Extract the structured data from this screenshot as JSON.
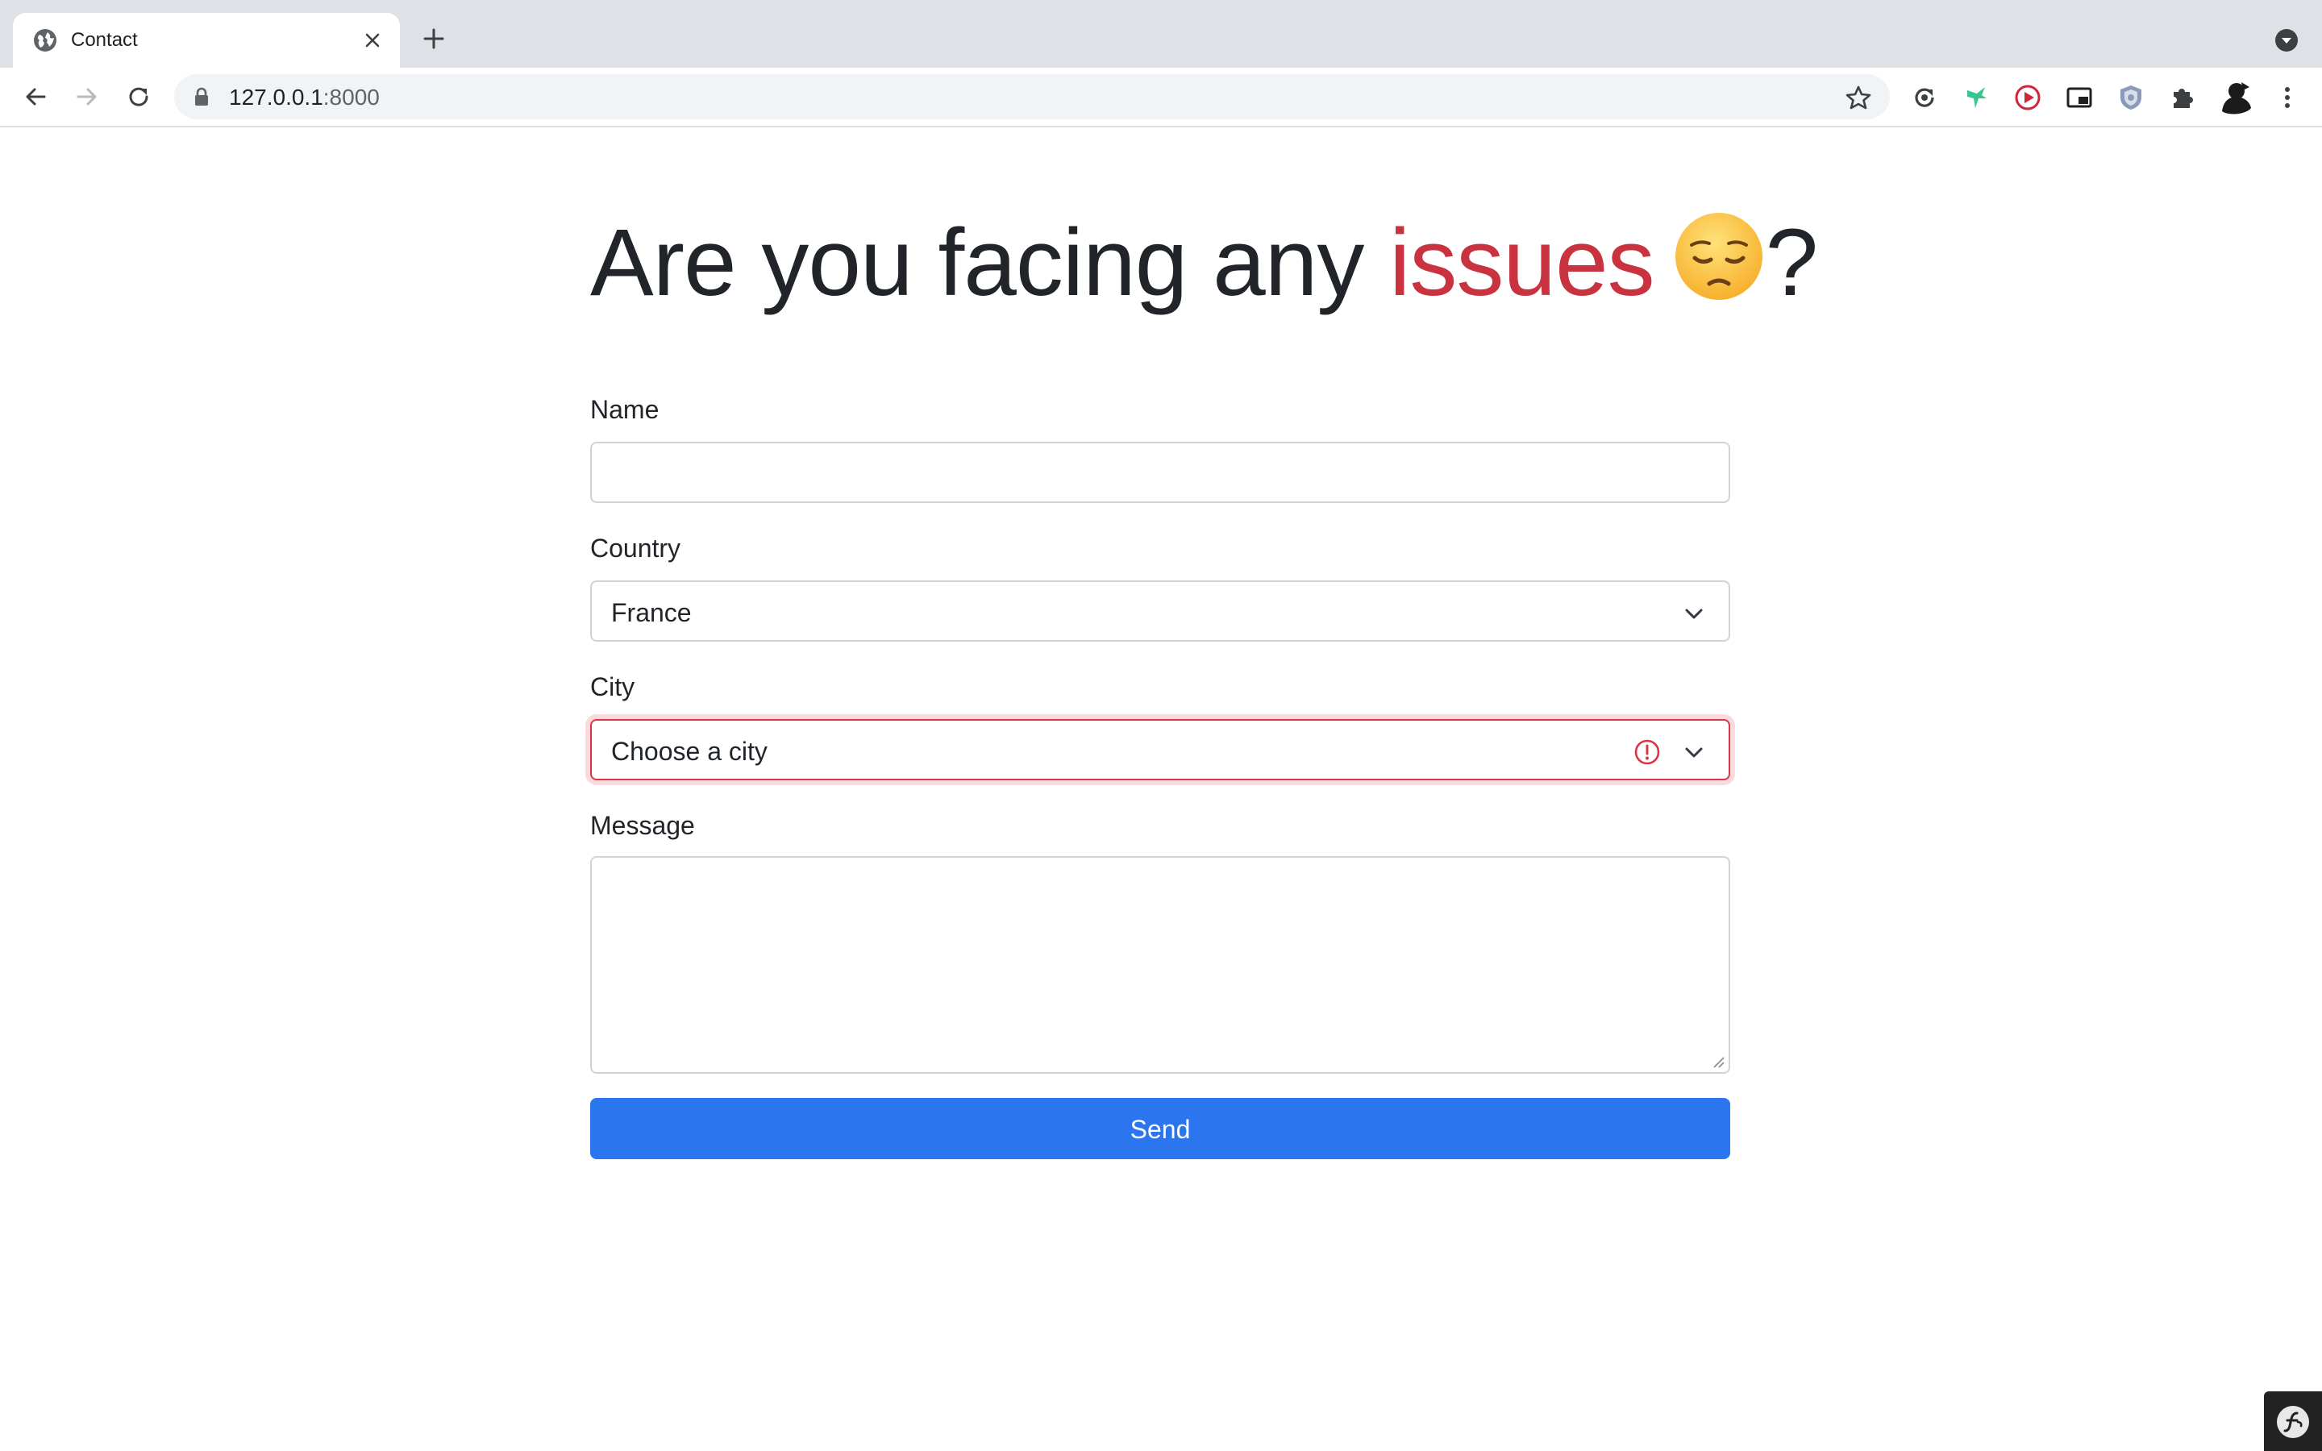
{
  "browser": {
    "tab_title": "Contact",
    "url_host": "127.0.0.1",
    "url_port": ":8000",
    "icons": [
      "globe-icon",
      "close-icon",
      "plus-icon",
      "chevron-down-icon",
      "back-arrow-icon",
      "forward-arrow-icon",
      "reload-icon",
      "lock-icon",
      "star-icon",
      "sync-extension-icon",
      "bird-extension-icon",
      "play-extension-icon",
      "picture-in-picture-icon",
      "shield-extension-icon",
      "puzzle-icon",
      "avatar",
      "more-vert-icon"
    ]
  },
  "heading": {
    "before": "Are you facing any ",
    "accent": "issues",
    "emoji_name": "pensive-face-emoji",
    "after": "?",
    "accent_color": "#c9333f"
  },
  "form": {
    "name_label": "Name",
    "name_value": "",
    "country_label": "Country",
    "country_value": "France",
    "city_label": "City",
    "city_value": "Choose a city",
    "city_state": "invalid",
    "message_label": "Message",
    "message_value": "",
    "submit_label": "Send",
    "submit_color": "#2b75ef",
    "error_color": "#dc3545"
  },
  "debug_toolbar": {
    "icon": "symfony-logo-icon"
  }
}
